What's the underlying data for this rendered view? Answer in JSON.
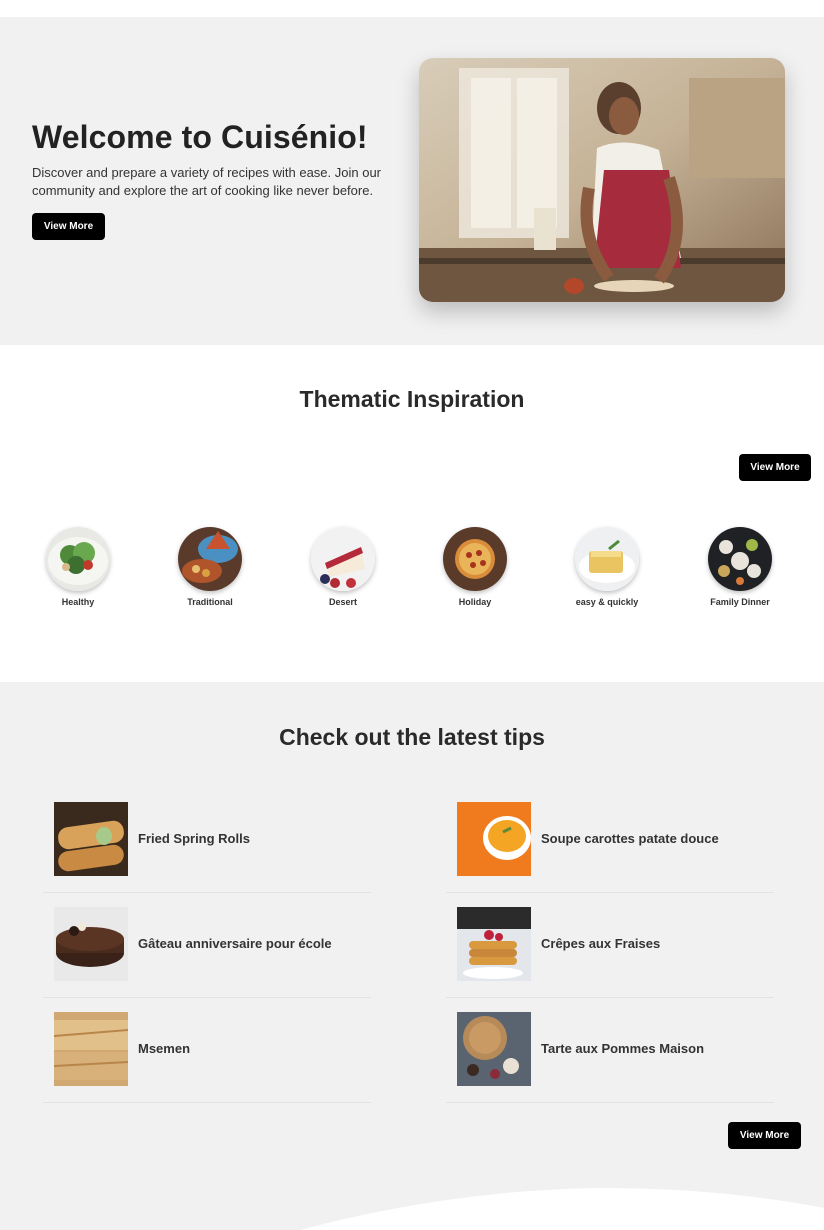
{
  "hero": {
    "title": "Welcome to Cuisénio!",
    "text": "Discover and prepare a variety of recipes with ease. Join our community and explore the art of cooking like never before.",
    "button": "View More"
  },
  "thematic": {
    "title": "Thematic Inspiration",
    "button": "View More",
    "categories": [
      {
        "label": "Healthy"
      },
      {
        "label": "Traditional"
      },
      {
        "label": "Desert"
      },
      {
        "label": "Holiday"
      },
      {
        "label": "easy & quickly"
      },
      {
        "label": "Family Dinner"
      }
    ]
  },
  "tips": {
    "title": "Check out the latest tips",
    "button": "View More",
    "items": [
      {
        "name": "Fried Spring Rolls"
      },
      {
        "name": "Soupe carottes patate douce"
      },
      {
        "name": "Gâteau anniversaire pour école"
      },
      {
        "name": "Crêpes aux Fraises"
      },
      {
        "name": "Msemen"
      },
      {
        "name": "Tarte aux Pommes Maison"
      }
    ]
  },
  "colors": {
    "background": "#ffffff",
    "section_gray": "#f1f1f1",
    "button": "#000000",
    "button_text": "#ffffff",
    "heading": "#222222"
  }
}
